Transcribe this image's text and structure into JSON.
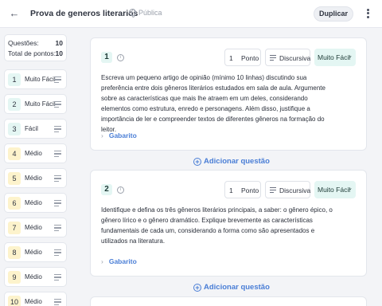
{
  "header": {
    "back_icon": "arrow-left-icon",
    "title": "Prova de generos literarios",
    "visibility": "Pública",
    "duplicate_label": "Duplicar",
    "menu_icon": "kebab-menu-icon"
  },
  "summary": {
    "questions_label": "Questões:",
    "questions_value": "10",
    "points_label": "Total de pontos:",
    "points_value": "10"
  },
  "colors": {
    "difficulty_easy_bg": "#e4f6f3",
    "difficulty_medium_bg": "#fdf3cc",
    "link": "#4a7ed6"
  },
  "sidebar": {
    "items": [
      {
        "num": "1",
        "label": "Muito Fácil"
      },
      {
        "num": "2",
        "label": "Muito Fácil"
      },
      {
        "num": "3",
        "label": "Fácil"
      },
      {
        "num": "4",
        "label": "Médio"
      },
      {
        "num": "5",
        "label": "Médio"
      },
      {
        "num": "6",
        "label": "Médio"
      },
      {
        "num": "7",
        "label": "Médio"
      },
      {
        "num": "8",
        "label": "Médio"
      },
      {
        "num": "9",
        "label": "Médio"
      },
      {
        "num": "10",
        "label": "Médio"
      }
    ]
  },
  "questions": [
    {
      "num": "1",
      "points_value": "1",
      "points_unit": "Ponto",
      "type": "Discursiva",
      "difficulty": "Muito Fácil",
      "text": "Escreva um pequeno artigo de opinião (mínimo 10 linhas) discutindo sua preferência entre dois gêneros literários estudados em sala de aula. Argumente sobre as características que mais lhe atraem em um deles, considerando elementos como estrutura, enredo e personagens. Além disso, justifique a importância de ler e compreender textos de diferentes gêneros na formação do leitor.",
      "answer_label": "Gabarito"
    },
    {
      "num": "2",
      "points_value": "1",
      "points_unit": "Ponto",
      "type": "Discursiva",
      "difficulty": "Muito Fácil",
      "text": "Identifique e defina os três gêneros literários principais, a saber: o gênero épico, o gênero lírico e o gênero dramático. Explique brevemente as características fundamentais de cada um, considerando a forma como são apresentados e utilizados na literatura.",
      "answer_label": "Gabarito"
    }
  ],
  "add_question_label": "Adicionar questão"
}
